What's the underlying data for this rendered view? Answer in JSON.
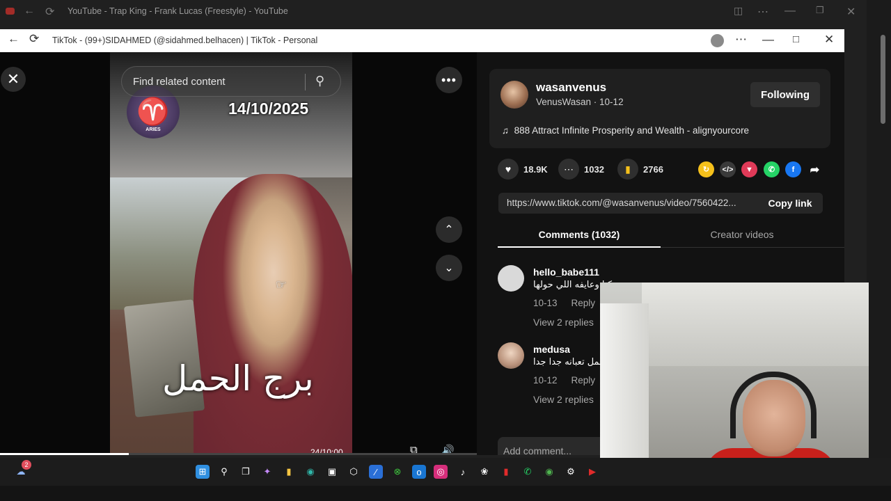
{
  "background_window": {
    "title": "YouTube - Trap King - Frank Lucas (Freestyle) - YouTube"
  },
  "window": {
    "title": "TikTok - (99+)SIDAHMED (@sidahmed.belhacen) | TikTok - Personal"
  },
  "video": {
    "search_placeholder": "Find related content",
    "sign_label": "ARIES",
    "overlay_date": "14/10/2025",
    "overlay_arabic": "برج الحمل",
    "timestamp": "24/10:00",
    "progress": 0.27
  },
  "creator": {
    "username": "wasanvenus",
    "sub": "VenusWasan · 10-12",
    "follow_label": "Following",
    "music": "888 Attract Infinite Prosperity and Wealth - alignyourcore"
  },
  "stats": {
    "likes": "18.9K",
    "comments": "1032",
    "saves": "2766"
  },
  "link": {
    "url": "https://www.tiktok.com/@wasanvenus/video/7560422...",
    "copy_label": "Copy link"
  },
  "tabs": {
    "comments": "Comments (1032)",
    "creator_videos": "Creator videos"
  },
  "comments": [
    {
      "user": "hello_babe111",
      "text": "كيا وعايفه اللي حولها",
      "date": "10-13",
      "reply": "Reply",
      "replies": "View 2 replies"
    },
    {
      "user": "medusa",
      "text": "حمل تعبانه جدا جدا",
      "date": "10-12",
      "reply": "Reply",
      "replies": "View 2 replies"
    }
  ],
  "add_comment_placeholder": "Add comment...",
  "taskbar": {
    "badge_count": "2"
  },
  "colors": {
    "panel_bg": "#121212",
    "card_bg": "#1f1f1f",
    "save_icon": "#f5c01b",
    "whatsapp": "#25d366",
    "facebook": "#1877f2",
    "repost": "#f5c01b",
    "red_share": "#e03a58"
  }
}
